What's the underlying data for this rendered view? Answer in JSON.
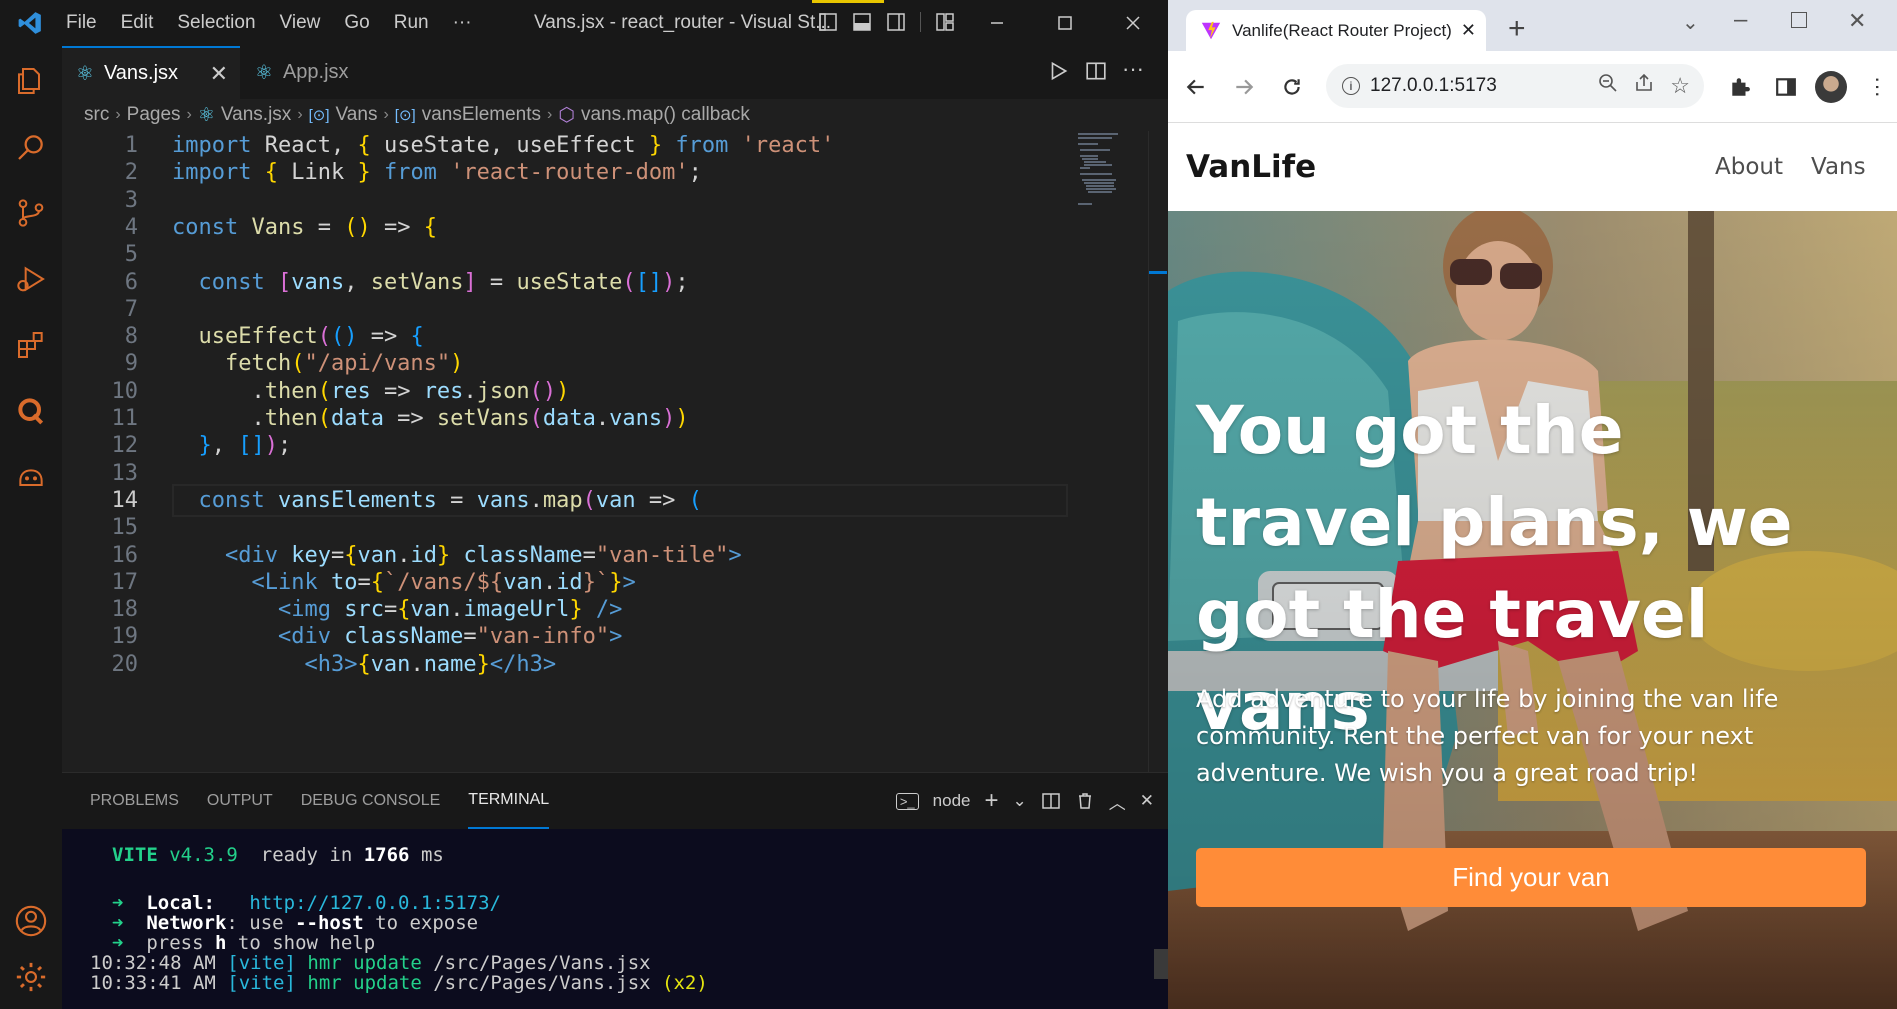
{
  "vscode": {
    "menu": [
      "File",
      "Edit",
      "Selection",
      "View",
      "Go",
      "Run",
      "···"
    ],
    "window_title": "Vans.jsx - react_router - Visual St...",
    "tabs": [
      {
        "label": "Vans.jsx",
        "active": true
      },
      {
        "label": "App.jsx",
        "active": false
      }
    ],
    "breadcrumb": [
      "src",
      "Pages",
      "Vans.jsx",
      "Vans",
      "vansElements",
      "vans.map() callback"
    ],
    "current_line": 14,
    "code_lines": [
      [
        [
          "kw",
          "import "
        ],
        [
          "pl",
          "React"
        ],
        [
          "pl",
          ", "
        ],
        [
          "br1",
          "{ "
        ],
        [
          "pl",
          "useState"
        ],
        [
          "pl",
          ", "
        ],
        [
          "pl",
          "useEffect"
        ],
        [
          "br1",
          " }"
        ],
        [
          "kw",
          " from "
        ],
        [
          "str",
          "'react'"
        ]
      ],
      [
        [
          "kw",
          "import "
        ],
        [
          "br1",
          "{ "
        ],
        [
          "pl",
          "Link"
        ],
        [
          "br1",
          " }"
        ],
        [
          "kw",
          " from "
        ],
        [
          "str",
          "'react-router-dom'"
        ],
        [
          "pl",
          ";"
        ]
      ],
      [],
      [
        [
          "kw",
          "const "
        ],
        [
          "fn",
          "Vans"
        ],
        [
          "pl",
          " = "
        ],
        [
          "br1",
          "()"
        ],
        [
          "pl",
          " => "
        ],
        [
          "br1",
          "{"
        ]
      ],
      [],
      [
        [
          "pl",
          "  "
        ],
        [
          "kw",
          "const "
        ],
        [
          "br2",
          "["
        ],
        [
          "var",
          "vans"
        ],
        [
          "pl",
          ", "
        ],
        [
          "fn",
          "setVans"
        ],
        [
          "br2",
          "]"
        ],
        [
          "pl",
          " = "
        ],
        [
          "fn",
          "useState"
        ],
        [
          "br2",
          "("
        ],
        [
          "br3",
          "[]"
        ],
        [
          "br2",
          ")"
        ],
        [
          "pl",
          ";"
        ]
      ],
      [],
      [
        [
          "pl",
          "  "
        ],
        [
          "fn",
          "useEffect"
        ],
        [
          "br2",
          "("
        ],
        [
          "br3",
          "()"
        ],
        [
          "pl",
          " => "
        ],
        [
          "br3",
          "{"
        ]
      ],
      [
        [
          "pl",
          "    "
        ],
        [
          "fn",
          "fetch"
        ],
        [
          "br1",
          "("
        ],
        [
          "str",
          "\"/api/vans\""
        ],
        [
          "br1",
          ")"
        ]
      ],
      [
        [
          "pl",
          "      ."
        ],
        [
          "fn",
          "then"
        ],
        [
          "br1",
          "("
        ],
        [
          "var",
          "res"
        ],
        [
          "pl",
          " => "
        ],
        [
          "var",
          "res"
        ],
        [
          "pl",
          "."
        ],
        [
          "fn",
          "json"
        ],
        [
          "br2",
          "()"
        ],
        [
          "br1",
          ")"
        ]
      ],
      [
        [
          "pl",
          "      ."
        ],
        [
          "fn",
          "then"
        ],
        [
          "br1",
          "("
        ],
        [
          "var",
          "data"
        ],
        [
          "pl",
          " => "
        ],
        [
          "fn",
          "setVans"
        ],
        [
          "br2",
          "("
        ],
        [
          "var",
          "data"
        ],
        [
          "pl",
          "."
        ],
        [
          "var",
          "vans"
        ],
        [
          "br2",
          ")"
        ],
        [
          "br1",
          ")"
        ]
      ],
      [
        [
          "pl",
          "  "
        ],
        [
          "br3",
          "}"
        ],
        [
          "pl",
          ", "
        ],
        [
          "br3",
          "[]"
        ],
        [
          "br2",
          ")"
        ],
        [
          "pl",
          ";"
        ]
      ],
      [],
      [
        [
          "pl",
          "  "
        ],
        [
          "kw",
          "const "
        ],
        [
          "var",
          "vansElements"
        ],
        [
          "pl",
          " = "
        ],
        [
          "var",
          "vans"
        ],
        [
          "pl",
          "."
        ],
        [
          "fn",
          "map"
        ],
        [
          "br2",
          "("
        ],
        [
          "var",
          "van"
        ],
        [
          "pl",
          " => "
        ],
        [
          "br3",
          "("
        ]
      ],
      [],
      [
        [
          "pl",
          "    "
        ],
        [
          "tag",
          "<div "
        ],
        [
          "attr",
          "key"
        ],
        [
          "pl",
          "="
        ],
        [
          "br1",
          "{"
        ],
        [
          "var",
          "van"
        ],
        [
          "pl",
          "."
        ],
        [
          "var",
          "id"
        ],
        [
          "br1",
          "}"
        ],
        [
          "attr",
          " className"
        ],
        [
          "pl",
          "="
        ],
        [
          "str",
          "\"van-tile\""
        ],
        [
          "tag",
          ">"
        ]
      ],
      [
        [
          "pl",
          "      "
        ],
        [
          "tag",
          "<Link "
        ],
        [
          "attr",
          "to"
        ],
        [
          "pl",
          "="
        ],
        [
          "br1",
          "{"
        ],
        [
          "str",
          "`/vans/${"
        ],
        [
          "var",
          "van"
        ],
        [
          "pl",
          "."
        ],
        [
          "var",
          "id"
        ],
        [
          "str",
          "}`"
        ],
        [
          "br1",
          "}"
        ],
        [
          "tag",
          ">"
        ]
      ],
      [
        [
          "pl",
          "        "
        ],
        [
          "tag",
          "<img "
        ],
        [
          "attr",
          "src"
        ],
        [
          "pl",
          "="
        ],
        [
          "br1",
          "{"
        ],
        [
          "var",
          "van"
        ],
        [
          "pl",
          "."
        ],
        [
          "var",
          "imageUrl"
        ],
        [
          "br1",
          "}"
        ],
        [
          "tag",
          " />"
        ]
      ],
      [
        [
          "pl",
          "        "
        ],
        [
          "tag",
          "<div "
        ],
        [
          "attr",
          "className"
        ],
        [
          "pl",
          "="
        ],
        [
          "str",
          "\"van-info\""
        ],
        [
          "tag",
          ">"
        ]
      ],
      [
        [
          "pl",
          "          "
        ],
        [
          "tag",
          "<h3>"
        ],
        [
          "br1",
          "{"
        ],
        [
          "var",
          "van"
        ],
        [
          "pl",
          "."
        ],
        [
          "var",
          "name"
        ],
        [
          "br1",
          "}"
        ],
        [
          "tag",
          "</h3>"
        ]
      ]
    ],
    "panel_tabs": [
      {
        "label": "PROBLEMS",
        "active": false
      },
      {
        "label": "OUTPUT",
        "active": false
      },
      {
        "label": "DEBUG CONSOLE",
        "active": false
      },
      {
        "label": "TERMINAL",
        "active": true
      }
    ],
    "terminal_shell": "node",
    "terminal": {
      "vite_label": "VITE",
      "vite_version": "v4.3.9",
      "ready_text": "ready in",
      "ready_ms": "1766",
      "ms": "ms",
      "local_label": "Local:",
      "local_url": "http://127.0.0.1:5173/",
      "network_label": "Network",
      "network_text": ": use ",
      "network_flag": "--host",
      "network_tail": " to expose",
      "help_pre": "press ",
      "help_key": "h",
      "help_tail": " to show help",
      "log1_time": "10:32:48 AM",
      "log1_tag": "[vite]",
      "log1_msg": "hmr update",
      "log1_path": "/src/Pages/Vans.jsx",
      "log2_time": "10:33:41 AM",
      "log2_tag": "[vite]",
      "log2_msg": "hmr update",
      "log2_path": "/src/Pages/Vans.jsx",
      "log2_count": "(x2)"
    },
    "colors": {
      "accent": "#0078d4",
      "bg": "#1f1f1f",
      "activity_icons": "#d96b2b"
    }
  },
  "browser": {
    "tab_title": "Vanlife(React Router Project)",
    "url": "127.0.0.1:5173",
    "site": {
      "logo": "VanLife",
      "nav": [
        "About",
        "Vans"
      ],
      "hero_title": "You got the travel plans, we got the travel vans",
      "hero_text": "Add adventure to your life by joining the van life community. Rent the perfect van for your next adventure.  We wish you a great road trip!",
      "cta": "Find your van",
      "cta_color": "#ff8c38"
    }
  }
}
